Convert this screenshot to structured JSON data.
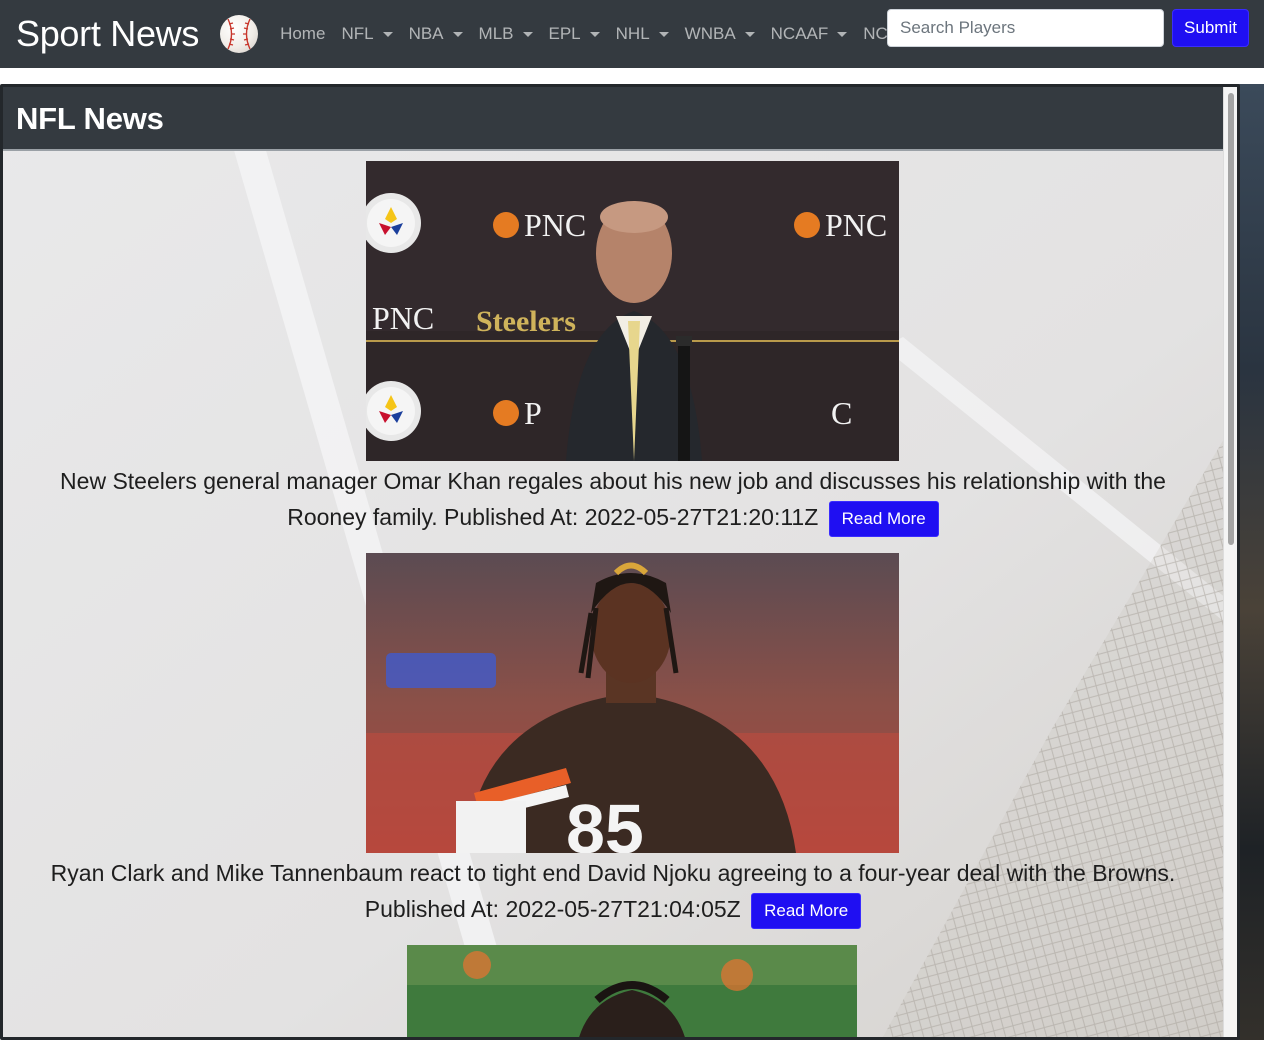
{
  "navbar": {
    "brand": "Sport News",
    "logo_icon": "baseball-icon",
    "links": [
      {
        "label": "Home",
        "dropdown": false
      },
      {
        "label": "NFL",
        "dropdown": true
      },
      {
        "label": "NBA",
        "dropdown": true
      },
      {
        "label": "MLB",
        "dropdown": true
      },
      {
        "label": "EPL",
        "dropdown": true
      },
      {
        "label": "NHL",
        "dropdown": true
      },
      {
        "label": "WNBA",
        "dropdown": true
      },
      {
        "label": "NCAAF",
        "dropdown": true
      },
      {
        "label": "NCAA",
        "dropdown": true
      }
    ],
    "search_placeholder": "Search Players",
    "submit_label": "Submit"
  },
  "panel": {
    "title": "NFL News"
  },
  "articles": [
    {
      "description": "New Steelers general manager Omar Khan regales about his new job and discusses his relationship with the Rooney family.",
      "published_prefix": "Published At:",
      "published_at": "2022-05-27T21:20:11Z",
      "read_more_label": "Read More"
    },
    {
      "description": "Ryan Clark and Mike Tannenbaum react to tight end David Njoku agreeing to a four-year deal with the Browns.",
      "published_prefix": "Published At:",
      "published_at": "2022-05-27T21:04:05Z",
      "read_more_label": "Read More"
    }
  ],
  "colors": {
    "navbar_bg": "#343a40",
    "primary_button": "#1f0ff2",
    "panel_header_bg": "#343a40"
  }
}
